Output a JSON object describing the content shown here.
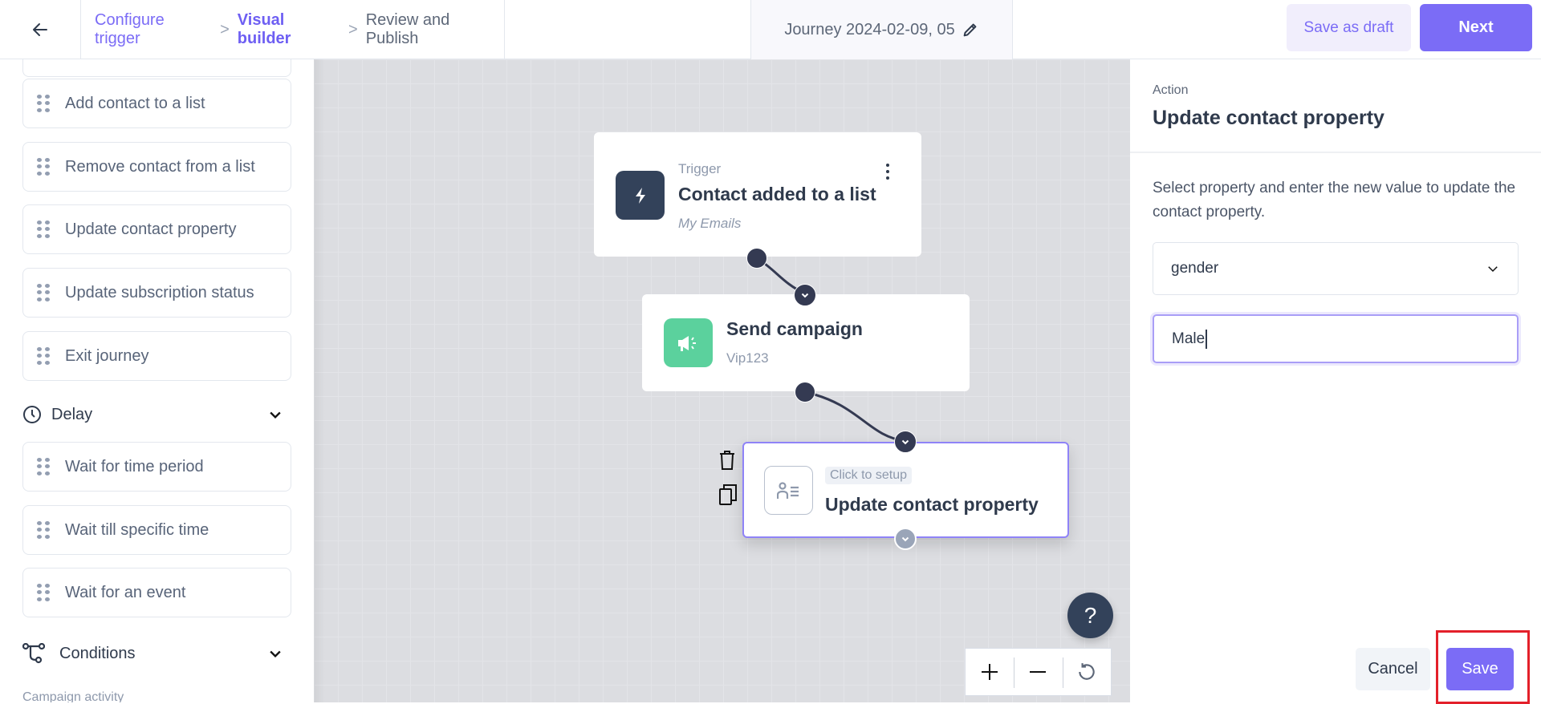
{
  "header": {
    "back_label": "Back",
    "breadcrumb": [
      {
        "label": "Configure trigger",
        "state": "done"
      },
      {
        "label": "Visual builder",
        "state": "active"
      },
      {
        "label": "Review and Publish",
        "state": "future"
      }
    ],
    "breadcrumb_separator": ">",
    "journey_title": "Journey 2024-02-09, 05",
    "save_draft_label": "Save as draft",
    "next_label": "Next"
  },
  "sidebar": {
    "action_items": [
      {
        "label": "Add contact to a list"
      },
      {
        "label": "Remove contact from a list"
      },
      {
        "label": "Update contact property"
      },
      {
        "label": "Update subscription status"
      },
      {
        "label": "Exit journey"
      }
    ],
    "delay": {
      "label": "Delay",
      "items": [
        {
          "label": "Wait for time period"
        },
        {
          "label": "Wait till specific time"
        },
        {
          "label": "Wait for an event"
        }
      ]
    },
    "conditions": {
      "label": "Conditions",
      "sub_label": "Campaign activity"
    }
  },
  "canvas": {
    "trigger_node": {
      "label": "Trigger",
      "title": "Contact added to a list",
      "subtitle": "My Emails",
      "icon_color": "#33425a"
    },
    "campaign_node": {
      "title": "Send campaign",
      "subtitle": "Vip123",
      "icon_color": "#5bd19d"
    },
    "update_node": {
      "badge": "Click to setup",
      "title": "Update contact property"
    },
    "help_label": "?",
    "zoom_in_label": "+",
    "zoom_out_label": "−"
  },
  "panel": {
    "kicker": "Action",
    "title": "Update contact property",
    "description": "Select property and enter the new value to update the contact property.",
    "property_select": {
      "value": "gender"
    },
    "value_input": {
      "value": "Male"
    },
    "cancel_label": "Cancel",
    "save_label": "Save"
  },
  "colors": {
    "accent": "#7b6cf6",
    "highlight": "#e3202a",
    "canvas_bg": "#dcdde1"
  }
}
